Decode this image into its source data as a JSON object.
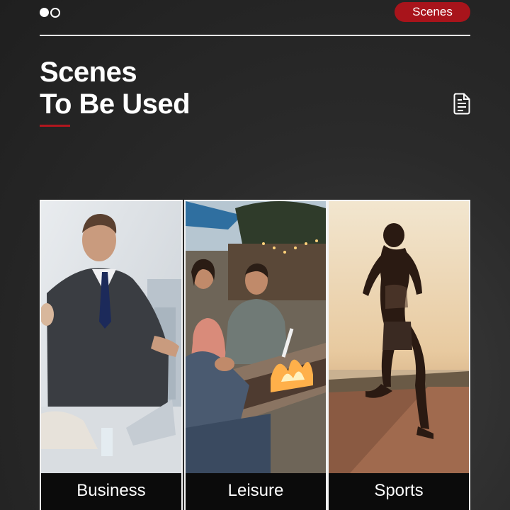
{
  "header": {
    "logo_icon": "two-circles-logo-icon",
    "pill_label": "Scenes",
    "pill_color": "#a8141b"
  },
  "title": {
    "line1": "Scenes",
    "line2": "To Be Used",
    "accent_color": "#b0161e"
  },
  "side_icon": "document-list-icon",
  "cards": [
    {
      "label": "Business"
    },
    {
      "label": "Leisure"
    },
    {
      "label": "Sports"
    }
  ]
}
